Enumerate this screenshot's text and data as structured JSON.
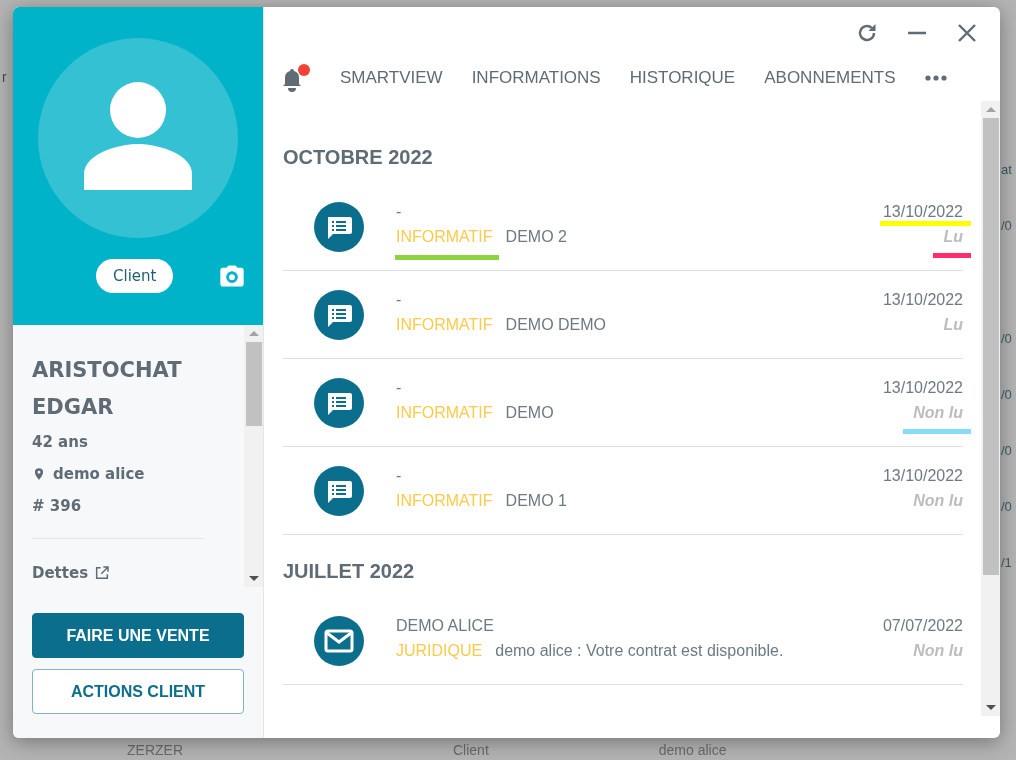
{
  "background": {
    "left_fragment": "r",
    "column_fragments": [
      "at",
      "/0",
      "/0",
      "/0",
      "/0",
      "/0",
      "/1"
    ],
    "bottom_row": [
      "ZERZER",
      "Client",
      "demo alice"
    ]
  },
  "profile": {
    "role_badge": "Client",
    "name_lines": [
      "ARISTOCHAT",
      "EDGAR"
    ],
    "age": "42 ans",
    "location": "demo alice",
    "number": "# 396",
    "link": "Dettes"
  },
  "actions": [
    {
      "label": "FAIRE UNE VENTE",
      "kind": "primary"
    },
    {
      "label": "ACTIONS CLIENT",
      "kind": "outline"
    }
  ],
  "bell": {
    "unread": true
  },
  "tabs": [
    "SMARTVIEW",
    "INFORMATIONS",
    "HISTORIQUE",
    "ABONNEMENTS"
  ],
  "sections": [
    {
      "title": "OCTOBRE 2022",
      "messages": [
        {
          "kind": "note",
          "title": "-",
          "tag": "INFORMATIF",
          "subject": "DEMO 2",
          "date": "13/10/2022",
          "status": "Lu",
          "tag_highlight": {
            "color": "#8fd13f"
          },
          "date_highlight": {
            "color": "#ffff00"
          },
          "status_highlight": {
            "color": "#ff2d6a"
          }
        },
        {
          "kind": "note",
          "title": "-",
          "tag": "INFORMATIF",
          "subject": "DEMO DEMO",
          "date": "13/10/2022",
          "status": "Lu"
        },
        {
          "kind": "note",
          "title": "-",
          "tag": "INFORMATIF",
          "subject": "DEMO",
          "date": "13/10/2022",
          "status": "Non lu",
          "status_highlight": {
            "color": "#87dcf7"
          }
        },
        {
          "kind": "note",
          "title": "-",
          "tag": "INFORMATIF",
          "subject": "DEMO 1",
          "date": "13/10/2022",
          "status": "Non lu"
        }
      ]
    },
    {
      "title": "JUILLET 2022",
      "messages": [
        {
          "kind": "mail",
          "title": "DEMO ALICE",
          "tag": "JURIDIQUE",
          "subject": "demo alice : Votre contrat est disponible.",
          "date": "07/07/2022",
          "status": "Non lu"
        }
      ]
    }
  ]
}
